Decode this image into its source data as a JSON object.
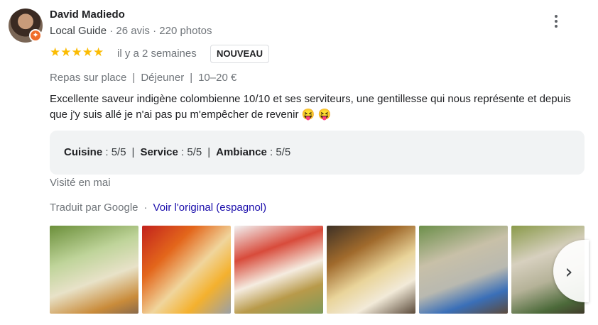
{
  "author": {
    "name": "David Madiedo",
    "level": "Local Guide",
    "meta": "· 26 avis · 220 photos"
  },
  "review_header": {
    "stars": "★★★★★",
    "rating": 5,
    "date": "il y a 2 semaines",
    "new_badge": "NOUVEAU"
  },
  "tags": [
    "Repas sur place",
    "Déjeuner",
    "10–20 €"
  ],
  "review_text": "Excellente saveur indigène colombienne 10/10 et ses serviteurs, une gentillesse qui nous représente et depuis que j'y suis allé je n'ai pas pu m'empêcher de revenir 😝 😝",
  "ratings": [
    {
      "label": "Cuisine",
      "value": ": 5/5"
    },
    {
      "label": "Service",
      "value": ": 5/5"
    },
    {
      "label": "Ambiance",
      "value": ": 5/5"
    }
  ],
  "visited": "Visité en mai",
  "translation": {
    "by": "Traduit par Google",
    "dot": "·",
    "link": "Voir l'original (espagnol)"
  },
  "icons": {
    "more": "more-vert-icon",
    "next": "chevron-right-icon",
    "next_glyph": "›",
    "badge_glyph": "✦"
  },
  "colors": {
    "star": "#fbbc04",
    "link": "#1a0dab",
    "badge": "#f06d2a"
  }
}
